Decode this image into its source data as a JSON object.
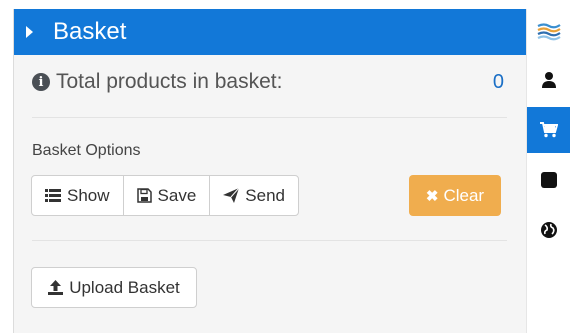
{
  "panel": {
    "title": "Basket",
    "total_label": "Total products in basket:",
    "total_count": "0",
    "options_label": "Basket Options",
    "buttons": {
      "show": "Show",
      "save": "Save",
      "send": "Send",
      "clear": "Clear",
      "upload": "Upload Basket"
    }
  },
  "sidebar": {
    "items": [
      {
        "icon": "layers-logo-icon",
        "active": false
      },
      {
        "icon": "user-icon",
        "active": false
      },
      {
        "icon": "shopping-cart-icon",
        "active": true
      },
      {
        "icon": "square-icon",
        "active": false
      },
      {
        "icon": "globe-icon",
        "active": false
      }
    ]
  },
  "colors": {
    "primary": "#1278d8",
    "warning": "#f0ad4e",
    "count": "#1a6fc6"
  }
}
